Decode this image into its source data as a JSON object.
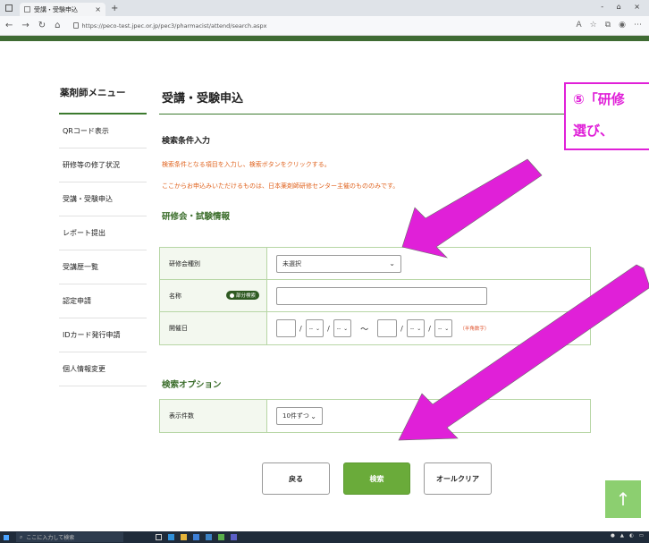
{
  "browser": {
    "tab_title": "受講・受験申込",
    "tab_close": "×",
    "new_tab": "+",
    "url": "https://peco-test.jpec.or.jp/pec3/pharmacist/attend/search.aspx",
    "window_controls": "- ⌂ ×"
  },
  "sidebar": {
    "title": "薬剤師メニュー",
    "items": [
      {
        "label": "QRコード表示"
      },
      {
        "label": "研修等の修了状況"
      },
      {
        "label": "受講・受験申込"
      },
      {
        "label": "レポート提出"
      },
      {
        "label": "受講歴一覧"
      },
      {
        "label": "認定申請"
      },
      {
        "label": "IDカード発行申請"
      },
      {
        "label": "個人情報変更"
      }
    ]
  },
  "main": {
    "title": "受講・受験申込",
    "search_heading": "検索条件入力",
    "note1": "検索条件となる項目を入力し、検索ボタンをクリックする。",
    "note2": "ここからお申込みいただけるものは、日本薬剤師研修センター主催のもののみです。",
    "section1_title": "研修会・試験情報",
    "fields": {
      "type_label": "研修会種別",
      "type_value": "未選択",
      "name_label": "名称",
      "partial_badge": "部分検索",
      "date_label": "開催日",
      "date_placeholder": "--",
      "date_sep": "/",
      "range_sep": "〜",
      "halfwidth_note": "（半角数字）"
    },
    "section2_title": "検索オプション",
    "display_label": "表示件数",
    "display_value": "10件ずつ"
  },
  "buttons": {
    "back": "戻る",
    "search": "検索",
    "clear": "オールクリア",
    "page_top": "↑"
  },
  "annotation": {
    "line1": "⑤「研修",
    "line2": "選び、",
    "color": "#e020d8"
  },
  "taskbar": {
    "search_placeholder": "ここに入力して検索"
  }
}
